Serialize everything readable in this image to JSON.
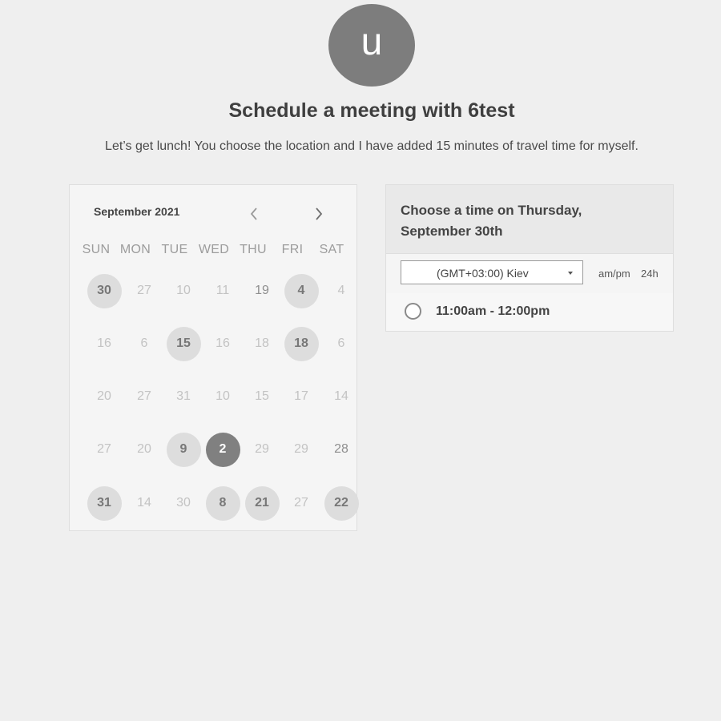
{
  "avatar": {
    "initial": "u"
  },
  "header": {
    "title": "Schedule a meeting with 6test",
    "description": "Let’s get lunch! You choose the location and I have added 15 minutes of travel time for myself."
  },
  "calendar": {
    "month_label": "September 2021",
    "prev_icon": "chevron-left-icon",
    "next_icon": "chevron-right-icon",
    "weekdays": [
      "SUN",
      "MON",
      "TUE",
      "WED",
      "THU",
      "FRI",
      "SAT"
    ],
    "weeks": [
      [
        {
          "label": "30",
          "state": "available"
        },
        {
          "label": "27",
          "state": "disabled"
        },
        {
          "label": "10",
          "state": "disabled"
        },
        {
          "label": "11",
          "state": "disabled"
        },
        {
          "label": "19",
          "state": "muted"
        },
        {
          "label": "4",
          "state": "available"
        },
        {
          "label": "4",
          "state": "disabled"
        }
      ],
      [
        {
          "label": "16",
          "state": "disabled"
        },
        {
          "label": "6",
          "state": "disabled"
        },
        {
          "label": "15",
          "state": "available"
        },
        {
          "label": "16",
          "state": "disabled"
        },
        {
          "label": "18",
          "state": "disabled"
        },
        {
          "label": "18",
          "state": "available"
        },
        {
          "label": "6",
          "state": "disabled"
        }
      ],
      [
        {
          "label": "20",
          "state": "disabled"
        },
        {
          "label": "27",
          "state": "disabled"
        },
        {
          "label": "31",
          "state": "disabled"
        },
        {
          "label": "10",
          "state": "disabled"
        },
        {
          "label": "15",
          "state": "disabled"
        },
        {
          "label": "17",
          "state": "disabled"
        },
        {
          "label": "14",
          "state": "disabled"
        }
      ],
      [
        {
          "label": "27",
          "state": "disabled"
        },
        {
          "label": "20",
          "state": "disabled"
        },
        {
          "label": "9",
          "state": "available"
        },
        {
          "label": "2",
          "state": "selected"
        },
        {
          "label": "29",
          "state": "disabled"
        },
        {
          "label": "29",
          "state": "disabled"
        },
        {
          "label": "28",
          "state": "muted"
        }
      ],
      [
        {
          "label": "31",
          "state": "available"
        },
        {
          "label": "14",
          "state": "disabled"
        },
        {
          "label": "30",
          "state": "disabled"
        },
        {
          "label": "8",
          "state": "available"
        },
        {
          "label": "21",
          "state": "available"
        },
        {
          "label": "27",
          "state": "disabled"
        },
        {
          "label": "22",
          "state": "available"
        }
      ]
    ]
  },
  "time_panel": {
    "title": "Choose a time on Thursday, September 30th",
    "timezone": {
      "value": "(GMT+03:00) Kiev",
      "icon": "caret-down-icon"
    },
    "format_ampm": "am/pm",
    "format_24h": "24h",
    "slots": [
      {
        "label": "11:00am - 12:00pm"
      }
    ]
  }
}
